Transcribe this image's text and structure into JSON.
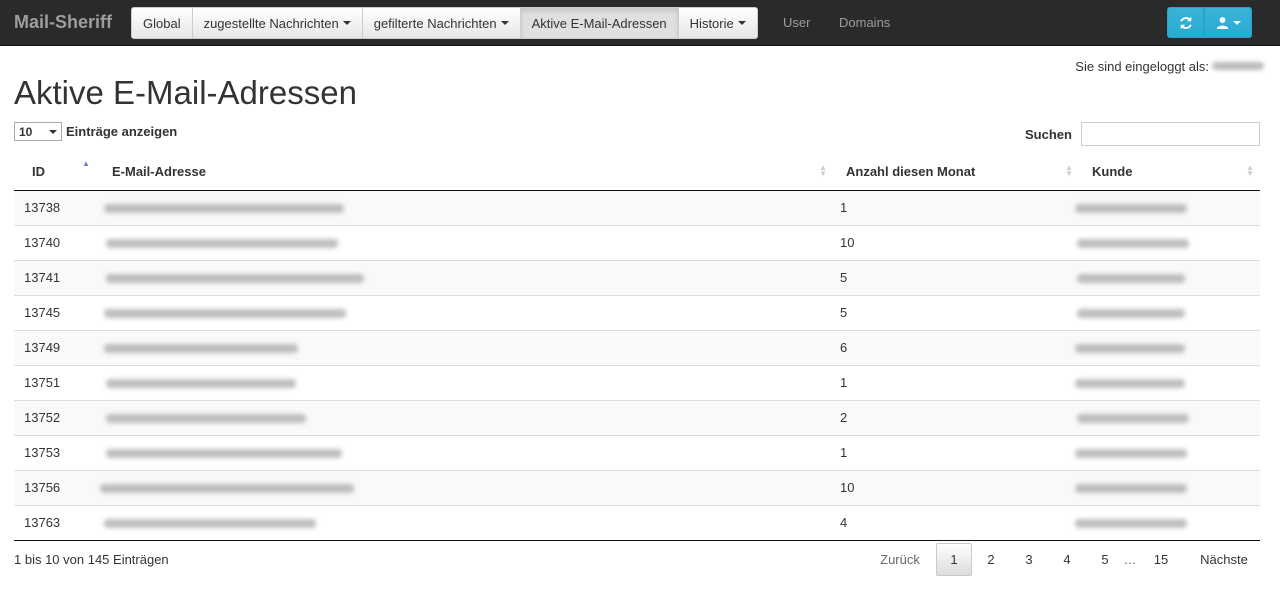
{
  "navbar": {
    "brand": "Mail-Sheriff",
    "items": [
      {
        "label": "Global",
        "dropdown": false,
        "active": false
      },
      {
        "label": "zugestellte Nachrichten",
        "dropdown": true,
        "active": false
      },
      {
        "label": "gefilterte Nachrichten",
        "dropdown": true,
        "active": false
      },
      {
        "label": "Aktive E-Mail-Adressen",
        "dropdown": false,
        "active": true
      },
      {
        "label": "Historie",
        "dropdown": true,
        "active": false
      }
    ],
    "links": [
      "User",
      "Domains"
    ],
    "icons": {
      "refresh": "refresh-icon",
      "user": "user-icon"
    },
    "accent_color": "#31b0d5"
  },
  "login_text": "Sie sind eingeloggt als:",
  "page_title": "Aktive E-Mail-Adressen",
  "length": {
    "value": "10",
    "label": "Einträge anzeigen"
  },
  "search": {
    "label": "Suchen",
    "value": ""
  },
  "table": {
    "columns": [
      "ID",
      "E-Mail-Adresse",
      "Anzahl diesen Monat",
      "Kunde"
    ],
    "rows": [
      {
        "id": "13738",
        "count": "1"
      },
      {
        "id": "13740",
        "count": "10"
      },
      {
        "id": "13741",
        "count": "5"
      },
      {
        "id": "13745",
        "count": "5"
      },
      {
        "id": "13749",
        "count": "6"
      },
      {
        "id": "13751",
        "count": "1"
      },
      {
        "id": "13752",
        "count": "2"
      },
      {
        "id": "13753",
        "count": "1"
      },
      {
        "id": "13756",
        "count": "10"
      },
      {
        "id": "13763",
        "count": "4"
      }
    ]
  },
  "info": "1 bis 10 von 145 Einträgen",
  "pagination": {
    "prev": "Zurück",
    "pages": [
      "1",
      "2",
      "3",
      "4",
      "5"
    ],
    "ellipsis": "…",
    "last": "15",
    "next": "Nächste",
    "current": "1"
  }
}
